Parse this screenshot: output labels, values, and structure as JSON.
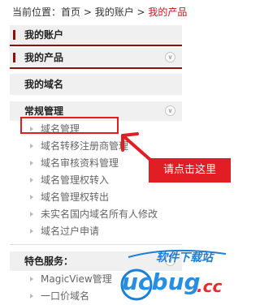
{
  "breadcrumb": {
    "prefix": "当前位置：",
    "home": "首页",
    "sep1": " > ",
    "account": "我的账户",
    "sep2": " > ",
    "current": "我的产品"
  },
  "menu": {
    "my_account": "我的账户",
    "my_products": "我的产品",
    "my_domains": "我的域名",
    "regular_mgmt": "常规管理",
    "regular_items": [
      "域名管理",
      "域名转移注册商管理",
      "域名审核资料管理",
      "域名管理权转入",
      "域名管理权转出",
      "未实名国内域名所有人修改",
      "域名过户申请"
    ],
    "features": "特色服务：",
    "feature_items": [
      "MagicView管理",
      "一口价域名"
    ]
  },
  "annotation": {
    "callout": "请点击这里"
  },
  "watermark": {
    "logo": "ucbug",
    "suffix": ".cc",
    "site": "软件下载站"
  }
}
